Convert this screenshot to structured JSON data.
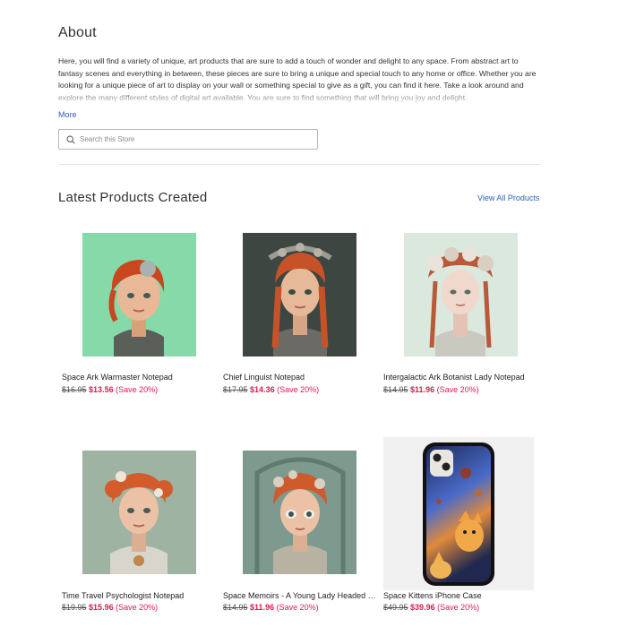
{
  "about": {
    "title": "About",
    "text": "Here, you will find a variety of unique, art products that are sure to add a touch of wonder and delight to any space. From abstract art to fantasy scenes and everything in between, these pieces are sure to bring a unique and special touch to any home or office. Whether you are looking for a unique piece of art to display on your wall or something special to give as a gift, you can find it here. Take a look around and explore the many different styles of digital art available. You are sure to find something that will bring you joy and delight.",
    "more_label": "More"
  },
  "search": {
    "placeholder": "Search this Store",
    "value": "",
    "icon": "search-icon"
  },
  "products_section": {
    "title": "Latest Products Created",
    "view_all_label": "View All Products"
  },
  "products": [
    {
      "name": "Space Ark Warmaster Notepad",
      "old_price": "$16.95",
      "new_price": "$13.56",
      "save": "(Save 20%)"
    },
    {
      "name": "Chief Linguist Notepad",
      "old_price": "$17.95",
      "new_price": "$14.36",
      "save": "(Save 20%)"
    },
    {
      "name": "Intergalactic Ark Botanist Lady Notepad",
      "old_price": "$14.95",
      "new_price": "$11.96",
      "save": "(Save 20%)"
    },
    {
      "name": "Time Travel Psychologist Notepad",
      "old_price": "$19.95",
      "new_price": "$15.96",
      "save": "(Save 20%)"
    },
    {
      "name": "Space Memoirs - A Young Lady Headed F...",
      "old_price": "$14.95",
      "new_price": "$11.96",
      "save": "(Save 20%)"
    },
    {
      "name": "Space Kittens iPhone Case",
      "old_price": "$49.95",
      "new_price": "$39.96",
      "save": "(Save 20%)"
    }
  ],
  "colors": {
    "link": "#2a61b8",
    "sale": "#e21a4b",
    "text": "#333333"
  }
}
